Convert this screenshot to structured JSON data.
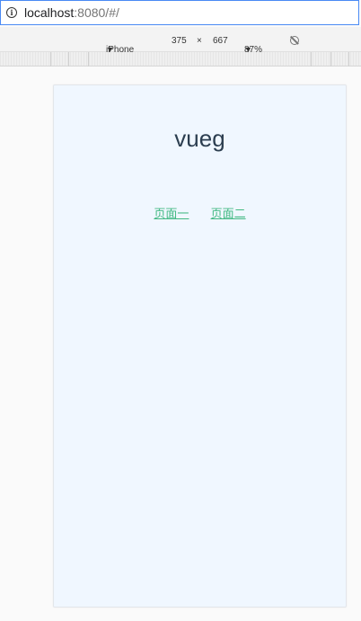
{
  "browser": {
    "url_host": "localhost",
    "url_rest": ":8080/#/"
  },
  "device_toolbar": {
    "device": "iPhone 6",
    "width": "375",
    "times": "×",
    "height": "667",
    "zoom": "87%",
    "caret": "▼"
  },
  "app": {
    "title": "vueg",
    "links": [
      "页面一",
      "页面二"
    ],
    "link_color": "#42b983",
    "title_color": "#2c3e50",
    "background": "#f0f7ff"
  },
  "icons": {
    "info": "info-icon",
    "rotate": "rotate-icon"
  }
}
